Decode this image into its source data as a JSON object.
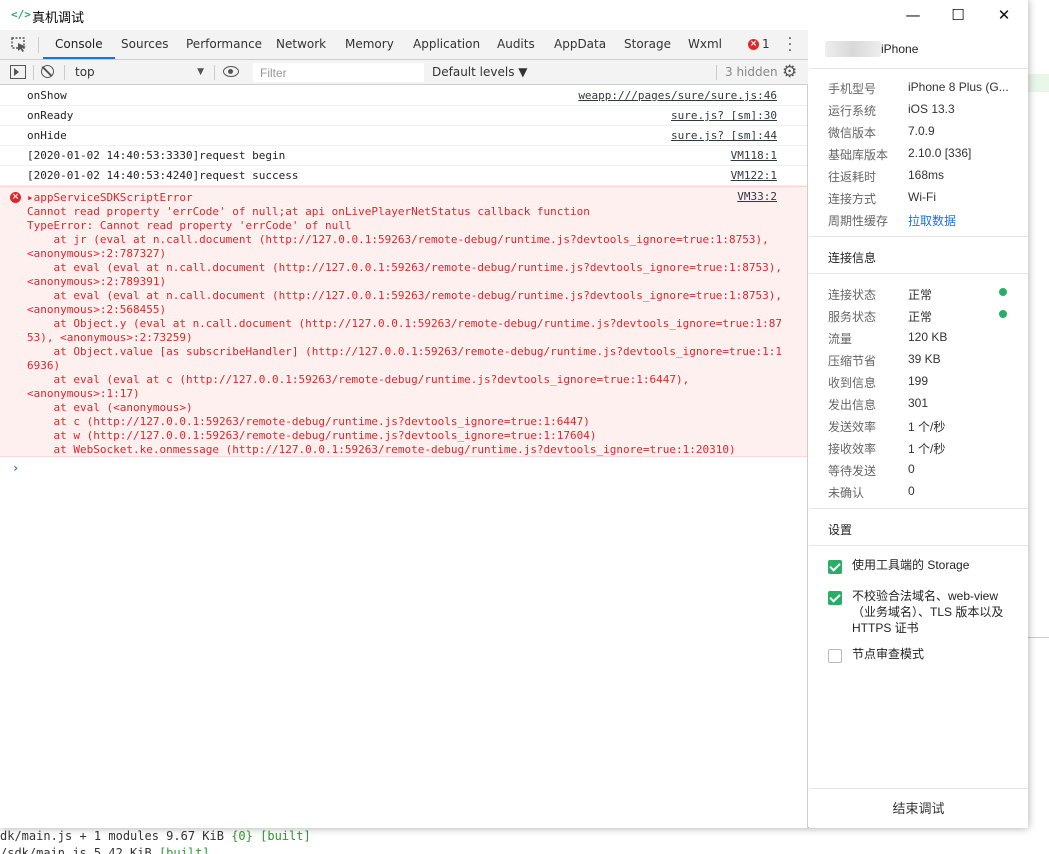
{
  "window": {
    "title": "真机调试",
    "title_icon": "</>",
    "controls": {
      "minimize": "—",
      "maximize": "☐",
      "close": "✕"
    }
  },
  "tabs": [
    "Console",
    "Sources",
    "Performance",
    "Network",
    "Memory",
    "Application",
    "Audits",
    "AppData",
    "Storage",
    "Wxml"
  ],
  "active_tab": "Console",
  "error_count": "1",
  "toolbar": {
    "context": "top",
    "filter_placeholder": "Filter",
    "levels": "Default levels ▼",
    "hidden": "3 hidden"
  },
  "logs": [
    {
      "text": "onShow",
      "source": "weapp:///pages/sure/sure.js:46"
    },
    {
      "text": "onReady",
      "source": "sure.js? [sm]:30"
    },
    {
      "text": "onHide",
      "source": "sure.js? [sm]:44"
    },
    {
      "text": "[2020-01-02 14:40:53:3330]request begin",
      "source": "VM118:1"
    },
    {
      "text": "[2020-01-02 14:40:53:4240]request success",
      "source": "VM122:1"
    }
  ],
  "error": {
    "source": "VM33:2",
    "lines": [
      "▸appServiceSDKScriptError",
      "Cannot read property 'errCode' of null;at api onLivePlayerNetStatus callback function",
      "TypeError: Cannot read property 'errCode' of null",
      "    at jr (eval at n.call.document (http://127.0.0.1:59263/remote-debug/runtime.js?devtools_ignore=true:1:8753),",
      "<anonymous>:2:787327)",
      "    at eval (eval at n.call.document (http://127.0.0.1:59263/remote-debug/runtime.js?devtools_ignore=true:1:8753),",
      "<anonymous>:2:789391)",
      "    at eval (eval at n.call.document (http://127.0.0.1:59263/remote-debug/runtime.js?devtools_ignore=true:1:8753),",
      "<anonymous>:2:568455)",
      "    at Object.y (eval at n.call.document (http://127.0.0.1:59263/remote-debug/runtime.js?devtools_ignore=true:1:87",
      "53), <anonymous>:2:73259)",
      "    at Object.value [as subscribeHandler] (http://127.0.0.1:59263/remote-debug/runtime.js?devtools_ignore=true:1:1",
      "6936)",
      "    at eval (eval at c (http://127.0.0.1:59263/remote-debug/runtime.js?devtools_ignore=true:1:6447),",
      "<anonymous>:1:17)",
      "    at eval (<anonymous>)",
      "    at c (http://127.0.0.1:59263/remote-debug/runtime.js?devtools_ignore=true:1:6447)",
      "    at w (http://127.0.0.1:59263/remote-debug/runtime.js?devtools_ignore=true:1:17604)",
      "    at WebSocket.ke.onmessage (http://127.0.0.1:59263/remote-debug/runtime.js?devtools_ignore=true:1:20310)"
    ]
  },
  "prompt": "›",
  "info": {
    "device": "iPhone",
    "device_rows": [
      {
        "label": "手机型号",
        "value": "iPhone 8 Plus (G..."
      },
      {
        "label": "运行系统",
        "value": "iOS 13.3"
      },
      {
        "label": "微信版本",
        "value": "7.0.9"
      },
      {
        "label": "基础库版本",
        "value": "2.10.0 [336]"
      },
      {
        "label": "往返耗时",
        "value": "168ms"
      },
      {
        "label": "连接方式",
        "value": "Wi-Fi"
      },
      {
        "label": "周期性缓存",
        "value": "拉取数据"
      }
    ],
    "conn_title": "连接信息",
    "conn_rows": [
      {
        "label": "连接状态",
        "value": "正常"
      },
      {
        "label": "服务状态",
        "value": "正常"
      },
      {
        "label": "流量",
        "value": "120 KB"
      },
      {
        "label": "压缩节省",
        "value": "39 KB"
      },
      {
        "label": "收到信息",
        "value": "199"
      },
      {
        "label": "发出信息",
        "value": "301"
      },
      {
        "label": "发送效率",
        "value": "1 个/秒"
      },
      {
        "label": "接收效率",
        "value": "1 个/秒"
      },
      {
        "label": "等待发送",
        "value": "0"
      },
      {
        "label": "未确认",
        "value": "0"
      }
    ],
    "settings_title": "设置",
    "settings": [
      {
        "label": "使用工具端的 Storage",
        "checked": true
      },
      {
        "label": "不校验合法域名、web-view（业务域名）、TLS 版本以及 HTTPS 证书",
        "checked": true
      },
      {
        "label": "节点审查模式",
        "checked": false
      }
    ],
    "end_button": "结束调试"
  },
  "terminal": {
    "line1_path": "dk/main.js + 1 modules ",
    "line1_size": "9.67 KiB ",
    "line1_chunk": "{0}",
    "line1_built": " [built]",
    "line2_path": "/sdk/main.js 5.42 KiB ",
    "line2_built": "[built]"
  },
  "colors": {
    "accent": "#1a73e8",
    "error": "#e0262a",
    "ok": "#2aae67"
  }
}
